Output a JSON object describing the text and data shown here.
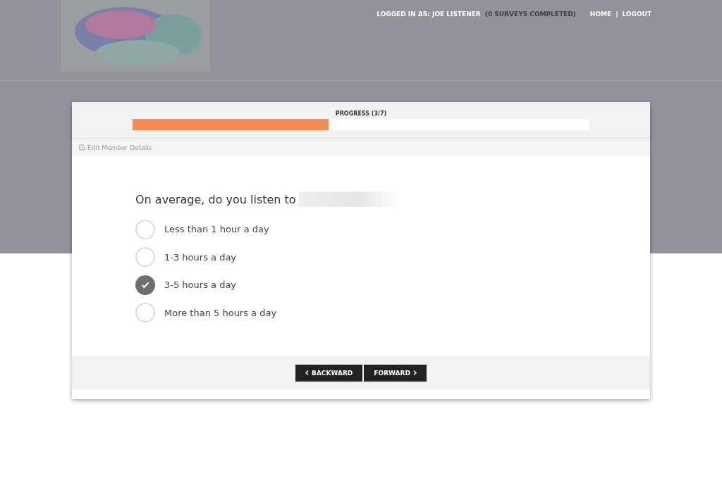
{
  "header": {
    "user_label": "LOGGED IN AS: JOE LISTENER",
    "user_count": "(0 SURVEYS COMPLETED)",
    "links": [
      "HOME",
      "LOGOUT"
    ],
    "separator": "|"
  },
  "progress": {
    "label": "PROGRESS (3/7)",
    "level": 0.4286
  },
  "edit_link": "Edit Member Details",
  "question": {
    "text": "On average, do you listen to",
    "options": [
      {
        "label": "Less than 1 hour a day",
        "selected": false
      },
      {
        "label": "1-3 hours a day",
        "selected": false
      },
      {
        "label": "3-5 hours a day",
        "selected": true
      },
      {
        "label": "More than 5 hours a day",
        "selected": false
      }
    ]
  },
  "buttons": [
    {
      "label": "BACKWARD",
      "kind": "back"
    },
    {
      "label": "FORWARD",
      "kind": "next"
    }
  ]
}
